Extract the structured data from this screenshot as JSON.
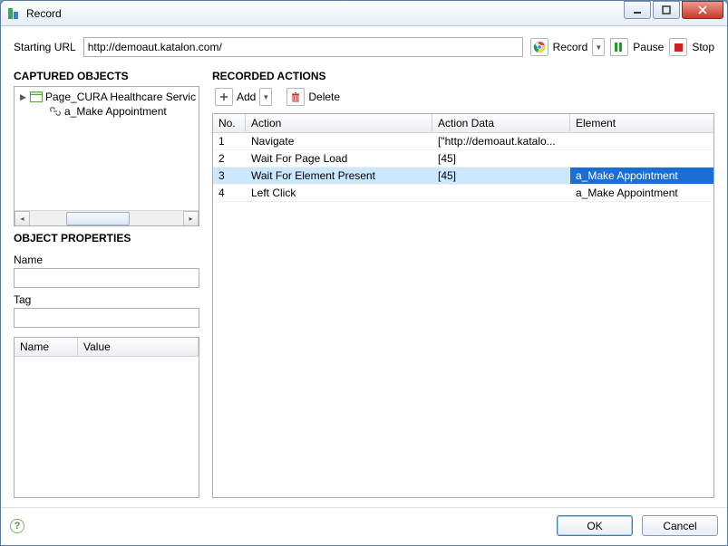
{
  "window": {
    "title": "Record"
  },
  "url": {
    "label": "Starting URL",
    "value": "http://demoaut.katalon.com/"
  },
  "toolbar": {
    "record_label": "Record",
    "pause_label": "Pause",
    "stop_label": "Stop"
  },
  "captured": {
    "heading": "CAPTURED OBJECTS",
    "tree": {
      "page": "Page_CURA Healthcare Servic",
      "child": "a_Make Appointment"
    }
  },
  "object_props": {
    "heading": "OBJECT PROPERTIES",
    "name_label": "Name",
    "name_value": "",
    "tag_label": "Tag",
    "tag_value": "",
    "table_cols": {
      "name": "Name",
      "value": "Value"
    }
  },
  "recorded": {
    "heading": "RECORDED ACTIONS",
    "add_label": "Add",
    "delete_label": "Delete",
    "columns": {
      "no": "No.",
      "action": "Action",
      "action_data": "Action Data",
      "element": "Element"
    },
    "rows": [
      {
        "no": "1",
        "action": "Navigate",
        "data": "[\"http://demoaut.katalo...",
        "element": ""
      },
      {
        "no": "2",
        "action": "Wait For Page Load",
        "data": "[45]",
        "element": ""
      },
      {
        "no": "3",
        "action": "Wait For Element Present",
        "data": "[45]",
        "element": "a_Make Appointment"
      },
      {
        "no": "4",
        "action": "Left Click",
        "data": "",
        "element": "a_Make Appointment"
      }
    ],
    "selected_index": 2
  },
  "footer": {
    "ok": "OK",
    "cancel": "Cancel"
  }
}
